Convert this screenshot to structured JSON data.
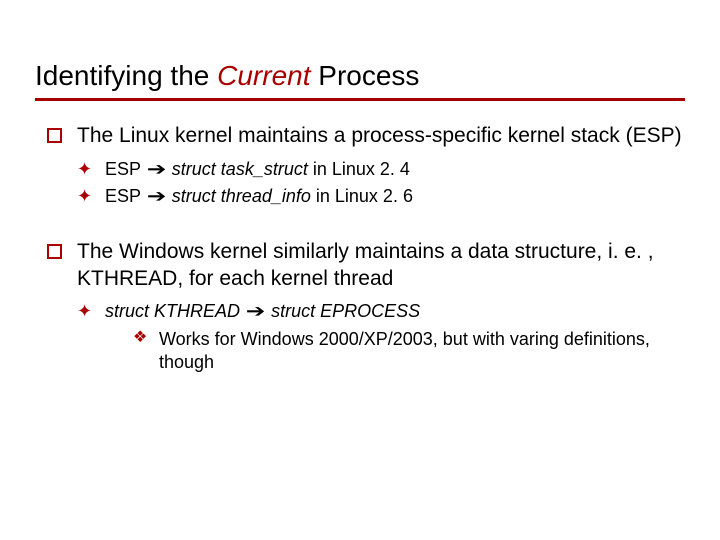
{
  "title": {
    "part1": "Identifying the ",
    "part2": "Current",
    "part3": " Process"
  },
  "items": [
    {
      "text": "The Linux kernel maintains a process-specific kernel stack (ESP)",
      "sub": [
        {
          "pre": "ESP ",
          "arrow": "➔",
          "ital": " struct task_struct ",
          "post": "in Linux 2. 4"
        },
        {
          "pre": "ESP ",
          "arrow": "➔",
          "ital": " struct thread_info ",
          "post": "in Linux 2. 6"
        }
      ]
    },
    {
      "text": "The Windows kernel similarly maintains a data structure, i. e. , KTHREAD, for each kernel thread",
      "sub": [
        {
          "ital1": "struct KTHREAD ",
          "arrow": "➔",
          "ital2": " struct EPROCESS",
          "subsub": [
            {
              "text": "Works for Windows 2000/XP/2003, but with varing definitions, though"
            }
          ]
        }
      ]
    }
  ]
}
